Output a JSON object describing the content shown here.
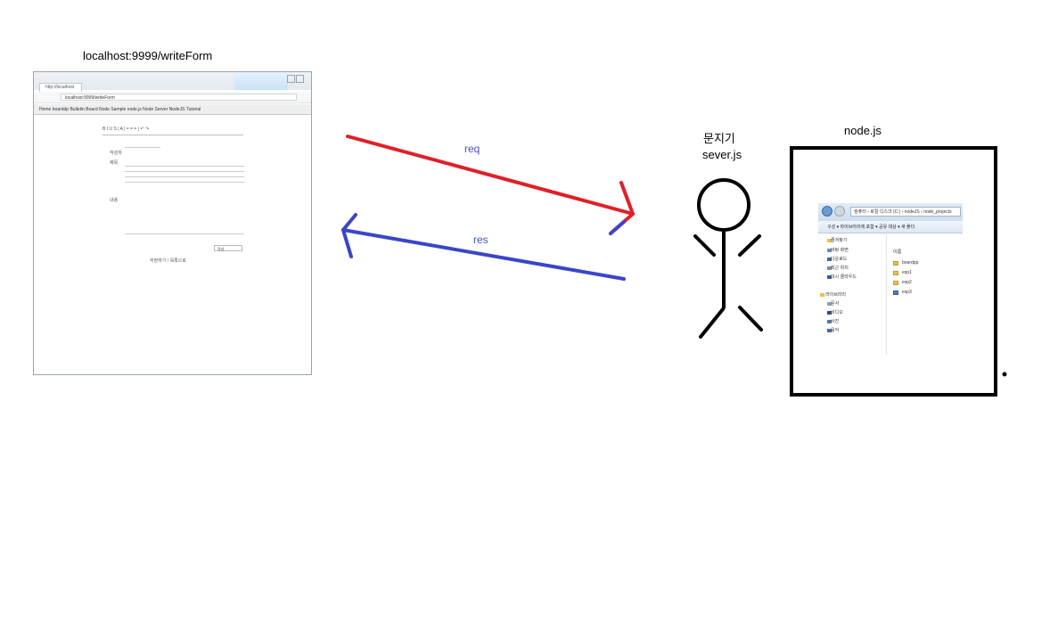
{
  "client_url": "localhost:9999/writeForm",
  "arrow_req": "req",
  "arrow_res": "res",
  "gatekeeper": {
    "title": "문지기",
    "subtitle": "sever.js"
  },
  "node_title": "node.js",
  "colors": {
    "req": "#e02028",
    "res": "#3a46c8",
    "figure": "#000000"
  },
  "browser": {
    "tab": "http://localhost",
    "address": "localhost:9999/writeForm",
    "bookmarks": "Home  boarddp  Bulletin Board  Node Sample  node.js  Node Server  NodeJS Tutorial",
    "toolbar": "B  I  U  S  |  A  |  =  =  =  |  ↶  ↷",
    "field1": "작성자",
    "field2": "제목",
    "field3": "내용",
    "submit": "작성",
    "footer": "저장하기 / 목록으로"
  },
  "explorer": {
    "path": "컴퓨터 › 로컬 디스크 (C:) › nodeJS › node_projects",
    "cmd": "구성 ▾    라이브러리에 포함 ▾    공유 대상 ▾    새 폴더",
    "sidebar": [
      "즐겨찾기",
      "바탕 화면",
      "다운로드",
      "최근 위치",
      "대시 클라우드",
      "라이브러리",
      "문서",
      "비디오",
      "사진",
      "음악"
    ],
    "header": "이름",
    "files": [
      "boardpp",
      "exp1",
      "exp2",
      "exp3"
    ]
  }
}
